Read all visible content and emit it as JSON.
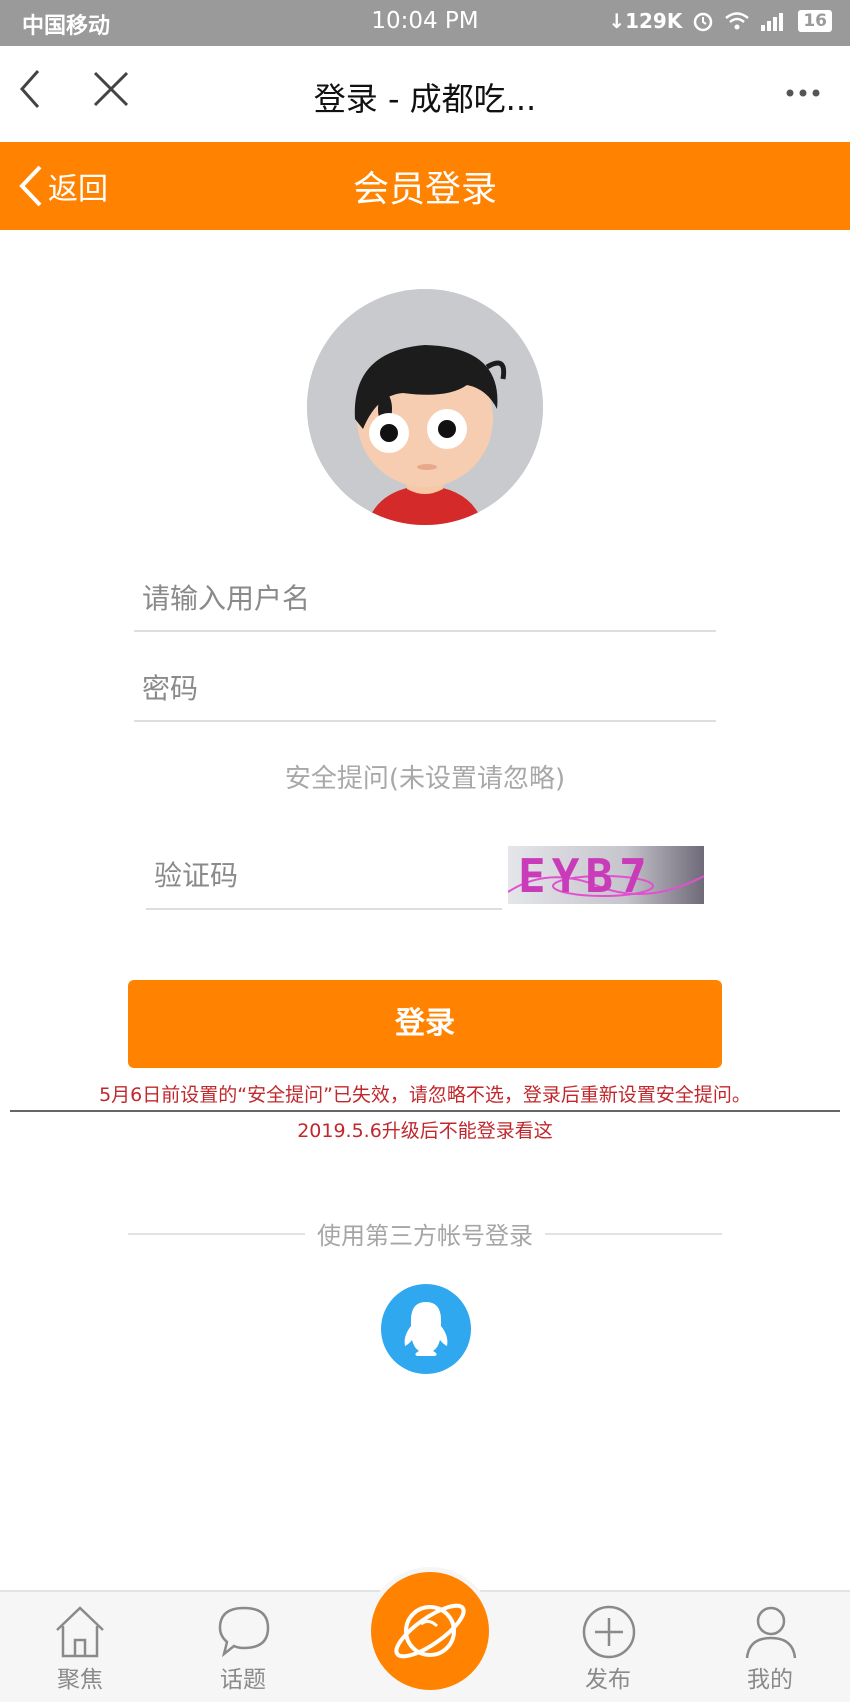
{
  "status_bar": {
    "carrier": "中国移动",
    "time": "10:04 PM",
    "net_speed": "129K",
    "battery": "16"
  },
  "browser": {
    "title": "登录 - 成都吃..."
  },
  "header": {
    "back_label": "返回",
    "title": "会员登录"
  },
  "form": {
    "username_placeholder": "请输入用户名",
    "password_placeholder": "密码",
    "security_question": "安全提问(未设置请忽略)",
    "captcha_placeholder": "验证码",
    "captcha_text": "EYB7",
    "login_label": "登录"
  },
  "notices": {
    "notice1": "5月6日前设置的“安全提问”已失效，请忽略不选，登录后重新设置安全提问。",
    "notice2": "2019.5.6升级后不能登录看这"
  },
  "third_party": {
    "label": "使用第三方帐号登录"
  },
  "tabbar": {
    "items": [
      {
        "label": "聚焦",
        "icon": "home-icon"
      },
      {
        "label": "话题",
        "icon": "chat-bubble-icon"
      },
      {
        "label": "",
        "icon": "planet-icon"
      },
      {
        "label": "发布",
        "icon": "plus-circle-icon"
      },
      {
        "label": "我的",
        "icon": "user-icon"
      }
    ]
  },
  "colors": {
    "accent": "#ff8300",
    "notice": "#c0282d",
    "qq": "#2fa8ef"
  }
}
